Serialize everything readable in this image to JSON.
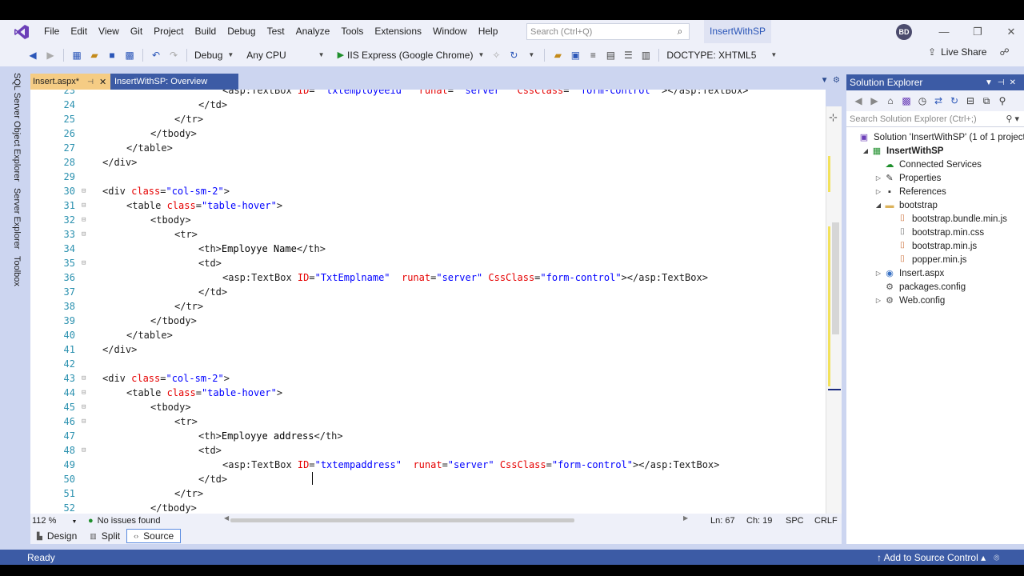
{
  "menu": {
    "items": [
      "File",
      "Edit",
      "View",
      "Git",
      "Project",
      "Build",
      "Debug",
      "Test",
      "Analyze",
      "Tools",
      "Extensions",
      "Window",
      "Help"
    ],
    "search_placeholder": "Search (Ctrl+Q)",
    "solution_title": "InsertWithSP",
    "avatar_initials": "BD"
  },
  "toolbar": {
    "configuration": "Debug",
    "platform": "Any CPU",
    "run_target": "IIS Express (Google Chrome)",
    "doctype": "DOCTYPE: XHTML5",
    "live_share": "Live Share"
  },
  "left_tabs": [
    "SQL Server Object Explorer",
    "Server Explorer",
    "Toolbox"
  ],
  "doc_tabs": {
    "active": "Insert.aspx*",
    "other": "InsertWithSP: Overview"
  },
  "editor": {
    "lines": [
      {
        "n": "23",
        "indent": 20,
        "parts": [
          [
            "tag",
            "<asp:TextBox "
          ],
          [
            "attr",
            "ID"
          ],
          [
            "tag",
            "= "
          ],
          [
            "val",
            "\"txtemployeeid\""
          ],
          [
            "tag",
            "  "
          ],
          [
            "attr",
            "runat"
          ],
          [
            "tag",
            "= "
          ],
          [
            "val",
            "\"server\""
          ],
          [
            "tag",
            "  "
          ],
          [
            "attr",
            "CssClass"
          ],
          [
            "tag",
            "= "
          ],
          [
            "val",
            "\"form-control\""
          ],
          [
            "tag",
            " ></asp:TextBox>"
          ]
        ]
      },
      {
        "n": "24",
        "indent": 16,
        "parts": [
          [
            "tag",
            "</td>"
          ]
        ]
      },
      {
        "n": "25",
        "indent": 12,
        "parts": [
          [
            "tag",
            "</tr>"
          ]
        ]
      },
      {
        "n": "26",
        "indent": 8,
        "parts": [
          [
            "tag",
            "</tbody>"
          ]
        ]
      },
      {
        "n": "27",
        "indent": 4,
        "parts": [
          [
            "tag",
            "</table>"
          ]
        ]
      },
      {
        "n": "28",
        "indent": 0,
        "parts": [
          [
            "tag",
            "</div>"
          ]
        ]
      },
      {
        "n": "29",
        "indent": 0,
        "parts": []
      },
      {
        "n": "30",
        "indent": 0,
        "fold": true,
        "parts": [
          [
            "tag",
            "<div "
          ],
          [
            "attr",
            "class"
          ],
          [
            "tag",
            "="
          ],
          [
            "val",
            "\"col-sm-2\""
          ],
          [
            "tag",
            ">"
          ]
        ]
      },
      {
        "n": "31",
        "indent": 4,
        "fold": true,
        "parts": [
          [
            "tag",
            "<table "
          ],
          [
            "attr",
            "class"
          ],
          [
            "tag",
            "="
          ],
          [
            "val",
            "\"table-hover\""
          ],
          [
            "tag",
            ">"
          ]
        ]
      },
      {
        "n": "32",
        "indent": 8,
        "fold": true,
        "parts": [
          [
            "tag",
            "<tbody>"
          ]
        ]
      },
      {
        "n": "33",
        "indent": 12,
        "fold": true,
        "parts": [
          [
            "tag",
            "<tr>"
          ]
        ]
      },
      {
        "n": "34",
        "indent": 16,
        "parts": [
          [
            "tag",
            "<th>"
          ],
          [
            "txt",
            "Employye Name"
          ],
          [
            "tag",
            "</th>"
          ]
        ]
      },
      {
        "n": "35",
        "indent": 16,
        "fold": true,
        "parts": [
          [
            "tag",
            "<td>"
          ]
        ]
      },
      {
        "n": "36",
        "indent": 20,
        "parts": [
          [
            "tag",
            "<asp:TextBox "
          ],
          [
            "attr",
            "ID"
          ],
          [
            "tag",
            "="
          ],
          [
            "val",
            "\"TxtEmplname\""
          ],
          [
            "tag",
            "  "
          ],
          [
            "attr",
            "runat"
          ],
          [
            "tag",
            "="
          ],
          [
            "val",
            "\"server\""
          ],
          [
            "tag",
            " "
          ],
          [
            "attr",
            "CssClass"
          ],
          [
            "tag",
            "="
          ],
          [
            "val",
            "\"form-control\""
          ],
          [
            "tag",
            "></asp:TextBox>"
          ]
        ]
      },
      {
        "n": "37",
        "indent": 16,
        "parts": [
          [
            "tag",
            "</td>"
          ]
        ]
      },
      {
        "n": "38",
        "indent": 12,
        "parts": [
          [
            "tag",
            "</tr>"
          ]
        ]
      },
      {
        "n": "39",
        "indent": 8,
        "parts": [
          [
            "tag",
            "</tbody>"
          ]
        ]
      },
      {
        "n": "40",
        "indent": 4,
        "parts": [
          [
            "tag",
            "</table>"
          ]
        ]
      },
      {
        "n": "41",
        "indent": 0,
        "parts": [
          [
            "tag",
            "</div>"
          ]
        ]
      },
      {
        "n": "42",
        "indent": 0,
        "parts": []
      },
      {
        "n": "43",
        "indent": 0,
        "fold": true,
        "parts": [
          [
            "tag",
            "<div "
          ],
          [
            "attr",
            "class"
          ],
          [
            "tag",
            "="
          ],
          [
            "val",
            "\"col-sm-2\""
          ],
          [
            "tag",
            ">"
          ]
        ]
      },
      {
        "n": "44",
        "indent": 4,
        "fold": true,
        "parts": [
          [
            "tag",
            "<table "
          ],
          [
            "attr",
            "class"
          ],
          [
            "tag",
            "="
          ],
          [
            "val",
            "\"table-hover\""
          ],
          [
            "tag",
            ">"
          ]
        ]
      },
      {
        "n": "45",
        "indent": 8,
        "fold": true,
        "parts": [
          [
            "tag",
            "<tbody>"
          ]
        ]
      },
      {
        "n": "46",
        "indent": 12,
        "fold": true,
        "parts": [
          [
            "tag",
            "<tr>"
          ]
        ]
      },
      {
        "n": "47",
        "indent": 16,
        "parts": [
          [
            "tag",
            "<th>"
          ],
          [
            "txt",
            "Employye address"
          ],
          [
            "tag",
            "</th>"
          ]
        ]
      },
      {
        "n": "48",
        "indent": 16,
        "fold": true,
        "parts": [
          [
            "tag",
            "<td>"
          ]
        ]
      },
      {
        "n": "49",
        "indent": 20,
        "parts": [
          [
            "tag",
            "<asp:TextBox "
          ],
          [
            "attr",
            "ID"
          ],
          [
            "tag",
            "="
          ],
          [
            "val",
            "\"txtempaddress\""
          ],
          [
            "tag",
            "  "
          ],
          [
            "attr",
            "runat"
          ],
          [
            "tag",
            "="
          ],
          [
            "val",
            "\"server\""
          ],
          [
            "tag",
            " "
          ],
          [
            "attr",
            "CssClass"
          ],
          [
            "tag",
            "="
          ],
          [
            "val",
            "\"form-control\""
          ],
          [
            "tag",
            "></asp:TextBox>"
          ]
        ]
      },
      {
        "n": "50",
        "indent": 16,
        "parts": [
          [
            "tag",
            "</td>"
          ]
        ]
      },
      {
        "n": "51",
        "indent": 12,
        "parts": [
          [
            "tag",
            "</tr>"
          ]
        ]
      },
      {
        "n": "52",
        "indent": 8,
        "parts": [
          [
            "tag",
            "</tbody>"
          ]
        ]
      }
    ]
  },
  "editor_status": {
    "zoom": "112 %",
    "issues": "No issues found",
    "line": "Ln: 67",
    "col": "Ch: 19",
    "spc": "SPC",
    "eol": "CRLF"
  },
  "view_tabs": {
    "design": "Design",
    "split": "Split",
    "source": "Source"
  },
  "solution_explorer": {
    "title": "Solution Explorer",
    "search_placeholder": "Search Solution Explorer (Ctrl+;)",
    "nodes": [
      {
        "label": "Solution 'InsertWithSP' (1 of 1 project)",
        "level": 0,
        "arrow": "",
        "icon": "solution-icon",
        "bold": false
      },
      {
        "label": "InsertWithSP",
        "level": 1,
        "arrow": "down",
        "icon": "web-project-icon",
        "bold": true
      },
      {
        "label": "Connected Services",
        "level": 2,
        "arrow": "",
        "icon": "connected-services-icon",
        "bold": false
      },
      {
        "label": "Properties",
        "level": 2,
        "arrow": "right",
        "icon": "wrench-icon",
        "bold": false
      },
      {
        "label": "References",
        "level": 2,
        "arrow": "right",
        "icon": "references-icon",
        "bold": false
      },
      {
        "label": "bootstrap",
        "level": 2,
        "arrow": "down",
        "icon": "folder-icon",
        "bold": false
      },
      {
        "label": "bootstrap.bundle.min.js",
        "level": 3,
        "arrow": "",
        "icon": "js-file-icon",
        "bold": false
      },
      {
        "label": "bootstrap.min.css",
        "level": 3,
        "arrow": "",
        "icon": "css-file-icon",
        "bold": false
      },
      {
        "label": "bootstrap.min.js",
        "level": 3,
        "arrow": "",
        "icon": "js-file-icon",
        "bold": false
      },
      {
        "label": "popper.min.js",
        "level": 3,
        "arrow": "",
        "icon": "js-file-icon",
        "bold": false
      },
      {
        "label": "Insert.aspx",
        "level": 2,
        "arrow": "right",
        "icon": "aspx-file-icon",
        "bold": false
      },
      {
        "label": "packages.config",
        "level": 2,
        "arrow": "",
        "icon": "config-file-icon",
        "bold": false
      },
      {
        "label": "Web.config",
        "level": 2,
        "arrow": "right",
        "icon": "config-file-icon",
        "bold": false
      }
    ]
  },
  "status_bar": {
    "ready": "Ready",
    "source_control": "Add to Source Control"
  },
  "colors": {
    "accent": "#3c5ba5",
    "active_tab": "#f5cc84",
    "attr": "#e50000",
    "value": "#0000ff",
    "line_number": "#2b91af"
  }
}
